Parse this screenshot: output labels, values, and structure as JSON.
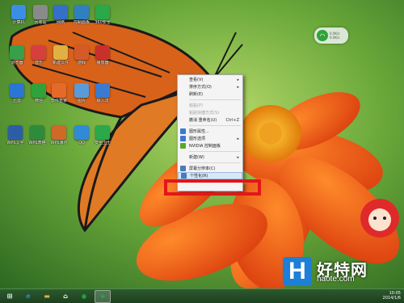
{
  "desktop_icons": [
    {
      "label": "计算机",
      "icon": "computer-icon",
      "color": "#3a8ee6"
    },
    {
      "label": "回收站",
      "icon": "recycle-bin-icon",
      "color": "#8a8a8a"
    },
    {
      "label": "网络",
      "icon": "network-icon",
      "color": "#3470c8"
    },
    {
      "label": "控制面板",
      "icon": "control-panel-icon",
      "color": "#2f7fc1"
    },
    {
      "label": "360安全",
      "icon": "shield-icon",
      "color": "#2aa84a"
    },
    {
      "label": "浏览器",
      "icon": "browser-icon",
      "color": "#38a04a"
    },
    {
      "label": "音乐",
      "icon": "music-icon",
      "color": "#d73f3f"
    },
    {
      "label": "新建文件",
      "icon": "folder-icon",
      "color": "#e0b040"
    },
    {
      "label": "游戏",
      "icon": "game-icon",
      "color": "#d45a2a"
    },
    {
      "label": "播放器",
      "icon": "player-icon",
      "color": "#c8302c"
    },
    {
      "label": "迅雷",
      "icon": "thunder-icon",
      "color": "#2a76d2"
    },
    {
      "label": "微信",
      "icon": "wechat-icon",
      "color": "#2fa33a"
    },
    {
      "label": "软件管家",
      "icon": "manager-icon",
      "color": "#e56a2a"
    },
    {
      "label": "图片",
      "icon": "picture-icon",
      "color": "#5a9ad8"
    },
    {
      "label": "输入法",
      "icon": "keyboard-icon",
      "color": "#3a7ad0"
    },
    {
      "label": "WPS文字",
      "icon": "wps-w-icon",
      "color": "#2c5ea8"
    },
    {
      "label": "WPS表格",
      "icon": "wps-s-icon",
      "color": "#2e8b3a"
    },
    {
      "label": "WPS演示",
      "icon": "wps-p-icon",
      "color": "#d06828"
    },
    {
      "label": "QQ",
      "icon": "qq-icon",
      "color": "#2f8ad8"
    },
    {
      "label": "安全卫士",
      "icon": "guard-icon",
      "color": "#2aa84a"
    }
  ],
  "network_widget": {
    "up": "0.0K/s",
    "down": "0.0K/s"
  },
  "context_menu": {
    "items": [
      {
        "type": "item",
        "label": "查看(V)",
        "arrow": "▸",
        "icon_color": ""
      },
      {
        "type": "item",
        "label": "排序方式(O)",
        "arrow": "▸",
        "icon_color": ""
      },
      {
        "type": "item",
        "label": "刷新(E)",
        "arrow": "",
        "icon_color": ""
      },
      {
        "type": "sep"
      },
      {
        "type": "item",
        "label": "粘贴(P)",
        "disabled": true,
        "arrow": "",
        "icon_color": ""
      },
      {
        "type": "item",
        "label": "粘贴快捷方式(S)",
        "disabled": true,
        "arrow": "",
        "icon_color": ""
      },
      {
        "type": "item",
        "label": "撤消 重命名(U)",
        "shortcut": "Ctrl+Z",
        "arrow": "",
        "icon_color": ""
      },
      {
        "type": "sep"
      },
      {
        "type": "item",
        "label": "图形属性...",
        "arrow": "",
        "icon_color": "#3a7ad0"
      },
      {
        "type": "item",
        "label": "图形选项",
        "arrow": "▸",
        "icon_color": "#3a7ad0"
      },
      {
        "type": "item",
        "label": "NVIDIA 控制面板",
        "arrow": "",
        "icon_color": "#5aa82a"
      },
      {
        "type": "sep"
      },
      {
        "type": "item",
        "label": "新建(W)",
        "arrow": "▸",
        "icon_color": ""
      },
      {
        "type": "sep"
      },
      {
        "type": "item",
        "label": "屏幕分辨率(C)",
        "arrow": "",
        "icon_color": "#4a7ab8"
      },
      {
        "type": "item",
        "label": "个性化(R)",
        "arrow": "",
        "icon_color": "#4a7ab8",
        "highlight": true
      }
    ]
  },
  "watermark": {
    "h": "H",
    "name": "好特网",
    "url": "haote.com"
  },
  "taskbar": {
    "buttons": [
      {
        "name": "start-button",
        "icon": "windows-start-icon",
        "glyph": "⊞",
        "color": "#ffffff"
      },
      {
        "name": "ie-button",
        "icon": "ie-icon",
        "glyph": "e",
        "color": "#2a8ad8"
      },
      {
        "name": "explorer-button",
        "icon": "folder-icon",
        "glyph": "▬",
        "color": "#e0b040"
      },
      {
        "name": "home-button",
        "icon": "home-icon",
        "glyph": "⌂",
        "color": "#ffffff"
      },
      {
        "name": "app-button",
        "icon": "app-icon",
        "glyph": "◉",
        "color": "#2aa84a"
      },
      {
        "name": "guard-button",
        "icon": "guard-icon",
        "glyph": "◈",
        "color": "#2aa84a",
        "active": true
      }
    ],
    "clock_time": "10:05",
    "clock_date": "2014/1/6"
  }
}
